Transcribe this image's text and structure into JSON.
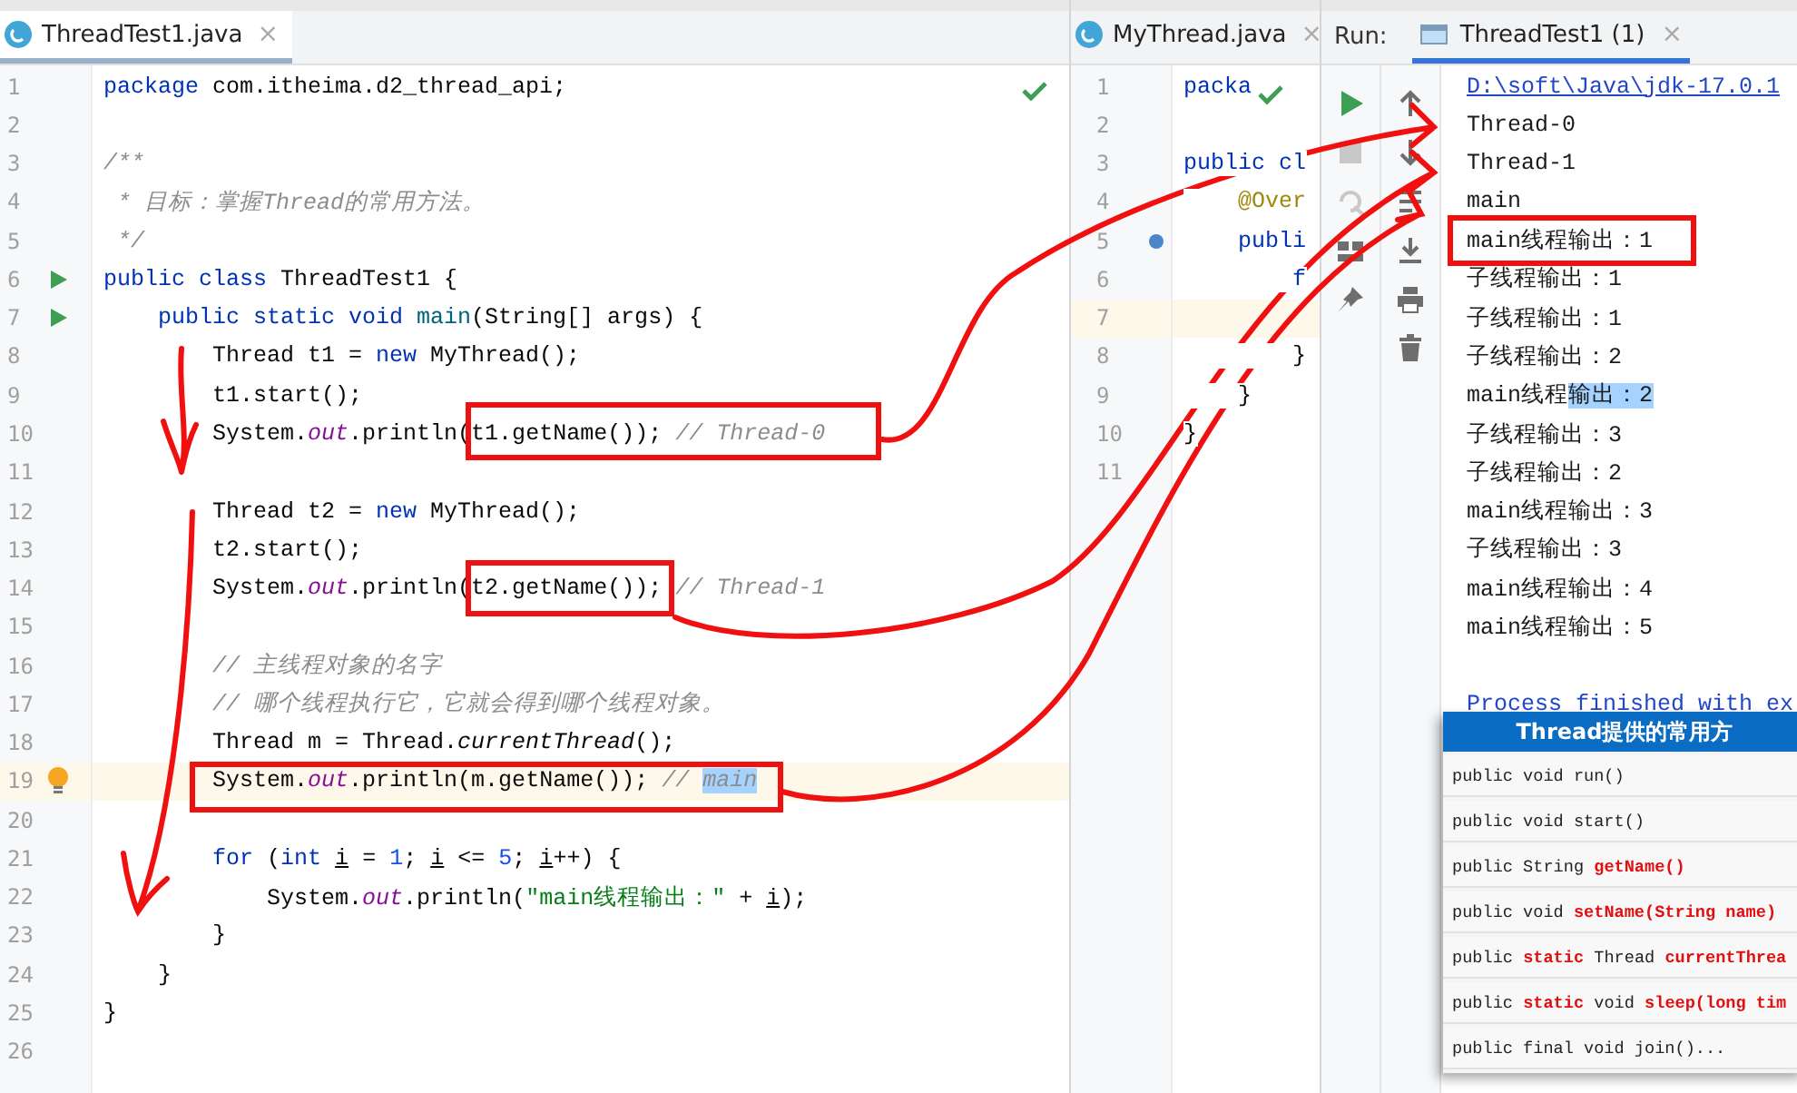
{
  "editor_left": {
    "tab": {
      "title": "ThreadTest1.java",
      "close": "×",
      "selected": true
    },
    "lines": [
      {
        "number": "1",
        "kind": "code",
        "current": false,
        "tokens": [
          {
            "kind": "kw",
            "text": "package"
          },
          {
            "kind": "plain",
            "text": " com.itheima.d2_thread_api;"
          }
        ]
      },
      {
        "number": "2",
        "kind": "code",
        "current": false
      },
      {
        "number": "3",
        "kind": "code",
        "current": false,
        "tokens": [
          {
            "kind": "cmt",
            "text": "/**"
          }
        ]
      },
      {
        "number": "4",
        "kind": "code",
        "current": false,
        "tokens": [
          {
            "kind": "cmt",
            "text": " * 目标：掌握Thread的常用方法。"
          }
        ]
      },
      {
        "number": "5",
        "kind": "code",
        "current": false,
        "tokens": [
          {
            "kind": "cmt",
            "text": " */"
          }
        ]
      },
      {
        "number": "6",
        "kind": "runnable",
        "current": false,
        "tokens": [
          {
            "kind": "kw",
            "text": "public class"
          },
          {
            "kind": "plain",
            "text": " ThreadTest1 {"
          }
        ]
      },
      {
        "number": "7",
        "kind": "runnable",
        "current": false,
        "tokens": [
          {
            "kind": "kw",
            "text": "    public static void "
          },
          {
            "kind": "decl",
            "text": "main"
          },
          {
            "kind": "plain",
            "text": "(String[] args) {"
          }
        ]
      },
      {
        "number": "8",
        "kind": "code",
        "current": false,
        "tokens": [
          {
            "kind": "plain",
            "text": "        Thread t1 = "
          },
          {
            "kind": "kw",
            "text": "new"
          },
          {
            "kind": "plain",
            "text": " MyThread();"
          }
        ]
      },
      {
        "number": "9",
        "kind": "code",
        "current": false,
        "tokens": [
          {
            "kind": "plain",
            "text": "        t1.start();"
          }
        ]
      },
      {
        "number": "10",
        "kind": "code",
        "current": false,
        "tokens": [
          {
            "kind": "plain",
            "text": "        System."
          },
          {
            "kind": "field",
            "text": "out"
          },
          {
            "kind": "plain",
            "text": ".println(t1.getName()); "
          },
          {
            "kind": "cmt",
            "text": "// Thread-0"
          }
        ]
      },
      {
        "number": "11",
        "kind": "code",
        "current": false
      },
      {
        "number": "12",
        "kind": "code",
        "current": false,
        "tokens": [
          {
            "kind": "plain",
            "text": "        Thread t2 = "
          },
          {
            "kind": "kw",
            "text": "new"
          },
          {
            "kind": "plain",
            "text": " MyThread();"
          }
        ]
      },
      {
        "number": "13",
        "kind": "code",
        "current": false,
        "tokens": [
          {
            "kind": "plain",
            "text": "        t2.start();"
          }
        ]
      },
      {
        "number": "14",
        "kind": "code",
        "current": false,
        "tokens": [
          {
            "kind": "plain",
            "text": "        System."
          },
          {
            "kind": "field",
            "text": "out"
          },
          {
            "kind": "plain",
            "text": ".println(t2.getName()); "
          },
          {
            "kind": "cmt",
            "text": "// Thread-1"
          }
        ]
      },
      {
        "number": "15",
        "kind": "code",
        "current": false
      },
      {
        "number": "16",
        "kind": "code",
        "current": false,
        "tokens": [
          {
            "kind": "cmt",
            "text": "        // 主线程对象的名字"
          }
        ]
      },
      {
        "number": "17",
        "kind": "code",
        "current": false,
        "tokens": [
          {
            "kind": "cmt",
            "text": "        // 哪个线程执行它，它就会得到哪个线程对象。"
          }
        ]
      },
      {
        "number": "18",
        "kind": "code",
        "current": false,
        "tokens": [
          {
            "kind": "plain",
            "text": "        Thread m = Thread."
          },
          {
            "kind": "ital",
            "text": "currentThread"
          },
          {
            "kind": "plain",
            "text": "();"
          }
        ]
      },
      {
        "number": "19",
        "kind": "hint",
        "current": true,
        "tokens": [
          {
            "kind": "plain",
            "text": "        System."
          },
          {
            "kind": "field",
            "text": "out"
          },
          {
            "kind": "plain",
            "text": ".println(m.getName()); "
          },
          {
            "kind": "cmt",
            "text": "// "
          },
          {
            "kind": "sel",
            "text": "main"
          }
        ]
      },
      {
        "number": "20",
        "kind": "code",
        "current": false
      },
      {
        "number": "21",
        "kind": "code",
        "current": false,
        "tokens": [
          {
            "kind": "kw",
            "text": "        for"
          },
          {
            "kind": "plain",
            "text": " ("
          },
          {
            "kind": "kw",
            "text": "int "
          },
          {
            "kind": "var",
            "text": "i"
          },
          {
            "kind": "plain",
            "text": " = "
          },
          {
            "kind": "num",
            "text": "1"
          },
          {
            "kind": "plain",
            "text": "; "
          },
          {
            "kind": "var",
            "text": "i"
          },
          {
            "kind": "plain",
            "text": " <= "
          },
          {
            "kind": "num",
            "text": "5"
          },
          {
            "kind": "plain",
            "text": "; "
          },
          {
            "kind": "var",
            "text": "i"
          },
          {
            "kind": "plain",
            "text": "++) {"
          }
        ]
      },
      {
        "number": "22",
        "kind": "code",
        "current": false,
        "tokens": [
          {
            "kind": "plain",
            "text": "            System."
          },
          {
            "kind": "field",
            "text": "out"
          },
          {
            "kind": "plain",
            "text": ".println("
          },
          {
            "kind": "str",
            "text": "\"main线程输出：\""
          },
          {
            "kind": "plain",
            "text": " + "
          },
          {
            "kind": "var",
            "text": "i"
          },
          {
            "kind": "plain",
            "text": ");"
          }
        ]
      },
      {
        "number": "23",
        "kind": "code",
        "current": false,
        "tokens": [
          {
            "kind": "plain",
            "text": "        }"
          }
        ]
      },
      {
        "number": "24",
        "kind": "code",
        "current": false,
        "tokens": [
          {
            "kind": "plain",
            "text": "    }"
          }
        ]
      },
      {
        "number": "25",
        "kind": "code",
        "current": false,
        "tokens": [
          {
            "kind": "plain",
            "text": "}"
          }
        ]
      },
      {
        "number": "26",
        "kind": "code",
        "current": false
      }
    ]
  },
  "editor_right": {
    "tab": {
      "title": "MyThread.java",
      "close": "×",
      "selected": false
    },
    "lines": [
      {
        "number": "1",
        "kind": "code",
        "current": false,
        "tokens": [
          {
            "kind": "kw",
            "text": "packa"
          }
        ]
      },
      {
        "number": "2",
        "kind": "code",
        "current": false
      },
      {
        "number": "3",
        "kind": "code",
        "current": false,
        "tokens": [
          {
            "kind": "kw",
            "text": "public cl"
          }
        ]
      },
      {
        "number": "4",
        "kind": "code",
        "current": false,
        "tokens": [
          {
            "kind": "anno",
            "text": "    @Over"
          }
        ]
      },
      {
        "number": "5",
        "kind": "override",
        "current": false,
        "tokens": [
          {
            "kind": "kw",
            "text": "    publi"
          }
        ]
      },
      {
        "number": "6",
        "kind": "code",
        "current": false,
        "tokens": [
          {
            "kind": "kw",
            "text": "        f"
          }
        ]
      },
      {
        "number": "7",
        "kind": "code",
        "current": true
      },
      {
        "number": "8",
        "kind": "code",
        "current": false,
        "tokens": [
          {
            "kind": "plain",
            "text": "        }"
          }
        ]
      },
      {
        "number": "9",
        "kind": "code",
        "current": false,
        "tokens": [
          {
            "kind": "plain",
            "text": "    }"
          }
        ]
      },
      {
        "number": "10",
        "kind": "code",
        "current": false,
        "tokens": [
          {
            "kind": "plain",
            "text": "}"
          }
        ]
      },
      {
        "number": "11",
        "kind": "code",
        "current": false
      }
    ]
  },
  "run_panel": {
    "label": "Run:",
    "tab": {
      "title": "ThreadTest1 (1)",
      "close": "×",
      "selected": true
    },
    "console": [
      {
        "kind": "link",
        "segments": [
          {
            "text": "D:\\soft\\Java\\jdk-17.0.1",
            "selected": false
          }
        ]
      },
      {
        "kind": "output",
        "segments": [
          {
            "text": "Thread-0",
            "selected": false
          }
        ]
      },
      {
        "kind": "output",
        "segments": [
          {
            "text": "Thread-1",
            "selected": false
          }
        ]
      },
      {
        "kind": "output",
        "segments": [
          {
            "text": "main",
            "selected": false
          }
        ]
      },
      {
        "kind": "output",
        "segments": [
          {
            "text": "main线程输出：1",
            "selected": false
          }
        ]
      },
      {
        "kind": "output",
        "segments": [
          {
            "text": "子线程输出：1",
            "selected": false
          }
        ]
      },
      {
        "kind": "output",
        "segments": [
          {
            "text": "子线程输出：1",
            "selected": false
          }
        ]
      },
      {
        "kind": "output",
        "segments": [
          {
            "text": "子线程输出：2",
            "selected": false
          }
        ]
      },
      {
        "kind": "output",
        "segments": [
          {
            "text": "main线程",
            "selected": false
          },
          {
            "text": "输出：2",
            "selected": true
          }
        ]
      },
      {
        "kind": "output",
        "segments": [
          {
            "text": "子线程输出：3",
            "selected": false
          }
        ]
      },
      {
        "kind": "output",
        "segments": [
          {
            "text": "子线程输出：2",
            "selected": false
          }
        ]
      },
      {
        "kind": "output",
        "segments": [
          {
            "text": "main线程输出：3",
            "selected": false
          }
        ]
      },
      {
        "kind": "output",
        "segments": [
          {
            "text": "子线程输出：3",
            "selected": false
          }
        ]
      },
      {
        "kind": "output",
        "segments": [
          {
            "text": "main线程输出：4",
            "selected": false
          }
        ]
      },
      {
        "kind": "output",
        "segments": [
          {
            "text": "main线程输出：5",
            "selected": false
          }
        ]
      },
      {
        "kind": "blank"
      },
      {
        "kind": "link",
        "segments": [
          {
            "text": "Process finished with ex",
            "selected": false
          }
        ]
      }
    ]
  },
  "methods_card": {
    "title": "Thread提供的常用方",
    "rows": [
      {
        "segments": [
          {
            "text": "public void run()",
            "highlight": false
          }
        ]
      },
      {
        "segments": [
          {
            "text": "public void start()",
            "highlight": false
          }
        ]
      },
      {
        "segments": [
          {
            "text": "public String ",
            "highlight": false
          },
          {
            "text": "getName()",
            "highlight": true
          }
        ]
      },
      {
        "segments": [
          {
            "text": "public void ",
            "highlight": false
          },
          {
            "text": "setName(String name)",
            "highlight": true
          }
        ]
      },
      {
        "segments": [
          {
            "text": "public ",
            "highlight": false
          },
          {
            "text": "static",
            "highlight": true
          },
          {
            "text": " Thread ",
            "highlight": false
          },
          {
            "text": "currentThrea",
            "highlight": true
          }
        ]
      },
      {
        "segments": [
          {
            "text": "public ",
            "highlight": false
          },
          {
            "text": "static",
            "highlight": true
          },
          {
            "text": " void ",
            "highlight": false
          },
          {
            "text": "sleep(long tim",
            "highlight": true
          }
        ]
      },
      {
        "segments": [
          {
            "text": "public final void join()...",
            "highlight": false
          }
        ]
      }
    ]
  }
}
